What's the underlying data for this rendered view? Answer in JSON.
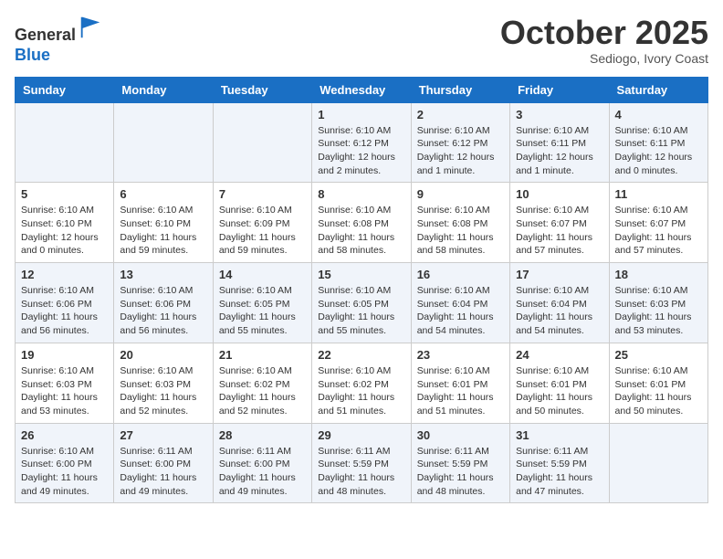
{
  "header": {
    "logo_line1": "General",
    "logo_line2": "Blue",
    "month": "October 2025",
    "location": "Sediogo, Ivory Coast"
  },
  "days_of_week": [
    "Sunday",
    "Monday",
    "Tuesday",
    "Wednesday",
    "Thursday",
    "Friday",
    "Saturday"
  ],
  "weeks": [
    [
      {
        "day": "",
        "info": ""
      },
      {
        "day": "",
        "info": ""
      },
      {
        "day": "",
        "info": ""
      },
      {
        "day": "1",
        "info": "Sunrise: 6:10 AM\nSunset: 6:12 PM\nDaylight: 12 hours and 2 minutes."
      },
      {
        "day": "2",
        "info": "Sunrise: 6:10 AM\nSunset: 6:12 PM\nDaylight: 12 hours and 1 minute."
      },
      {
        "day": "3",
        "info": "Sunrise: 6:10 AM\nSunset: 6:11 PM\nDaylight: 12 hours and 1 minute."
      },
      {
        "day": "4",
        "info": "Sunrise: 6:10 AM\nSunset: 6:11 PM\nDaylight: 12 hours and 0 minutes."
      }
    ],
    [
      {
        "day": "5",
        "info": "Sunrise: 6:10 AM\nSunset: 6:10 PM\nDaylight: 12 hours and 0 minutes."
      },
      {
        "day": "6",
        "info": "Sunrise: 6:10 AM\nSunset: 6:10 PM\nDaylight: 11 hours and 59 minutes."
      },
      {
        "day": "7",
        "info": "Sunrise: 6:10 AM\nSunset: 6:09 PM\nDaylight: 11 hours and 59 minutes."
      },
      {
        "day": "8",
        "info": "Sunrise: 6:10 AM\nSunset: 6:08 PM\nDaylight: 11 hours and 58 minutes."
      },
      {
        "day": "9",
        "info": "Sunrise: 6:10 AM\nSunset: 6:08 PM\nDaylight: 11 hours and 58 minutes."
      },
      {
        "day": "10",
        "info": "Sunrise: 6:10 AM\nSunset: 6:07 PM\nDaylight: 11 hours and 57 minutes."
      },
      {
        "day": "11",
        "info": "Sunrise: 6:10 AM\nSunset: 6:07 PM\nDaylight: 11 hours and 57 minutes."
      }
    ],
    [
      {
        "day": "12",
        "info": "Sunrise: 6:10 AM\nSunset: 6:06 PM\nDaylight: 11 hours and 56 minutes."
      },
      {
        "day": "13",
        "info": "Sunrise: 6:10 AM\nSunset: 6:06 PM\nDaylight: 11 hours and 56 minutes."
      },
      {
        "day": "14",
        "info": "Sunrise: 6:10 AM\nSunset: 6:05 PM\nDaylight: 11 hours and 55 minutes."
      },
      {
        "day": "15",
        "info": "Sunrise: 6:10 AM\nSunset: 6:05 PM\nDaylight: 11 hours and 55 minutes."
      },
      {
        "day": "16",
        "info": "Sunrise: 6:10 AM\nSunset: 6:04 PM\nDaylight: 11 hours and 54 minutes."
      },
      {
        "day": "17",
        "info": "Sunrise: 6:10 AM\nSunset: 6:04 PM\nDaylight: 11 hours and 54 minutes."
      },
      {
        "day": "18",
        "info": "Sunrise: 6:10 AM\nSunset: 6:03 PM\nDaylight: 11 hours and 53 minutes."
      }
    ],
    [
      {
        "day": "19",
        "info": "Sunrise: 6:10 AM\nSunset: 6:03 PM\nDaylight: 11 hours and 53 minutes."
      },
      {
        "day": "20",
        "info": "Sunrise: 6:10 AM\nSunset: 6:03 PM\nDaylight: 11 hours and 52 minutes."
      },
      {
        "day": "21",
        "info": "Sunrise: 6:10 AM\nSunset: 6:02 PM\nDaylight: 11 hours and 52 minutes."
      },
      {
        "day": "22",
        "info": "Sunrise: 6:10 AM\nSunset: 6:02 PM\nDaylight: 11 hours and 51 minutes."
      },
      {
        "day": "23",
        "info": "Sunrise: 6:10 AM\nSunset: 6:01 PM\nDaylight: 11 hours and 51 minutes."
      },
      {
        "day": "24",
        "info": "Sunrise: 6:10 AM\nSunset: 6:01 PM\nDaylight: 11 hours and 50 minutes."
      },
      {
        "day": "25",
        "info": "Sunrise: 6:10 AM\nSunset: 6:01 PM\nDaylight: 11 hours and 50 minutes."
      }
    ],
    [
      {
        "day": "26",
        "info": "Sunrise: 6:10 AM\nSunset: 6:00 PM\nDaylight: 11 hours and 49 minutes."
      },
      {
        "day": "27",
        "info": "Sunrise: 6:11 AM\nSunset: 6:00 PM\nDaylight: 11 hours and 49 minutes."
      },
      {
        "day": "28",
        "info": "Sunrise: 6:11 AM\nSunset: 6:00 PM\nDaylight: 11 hours and 49 minutes."
      },
      {
        "day": "29",
        "info": "Sunrise: 6:11 AM\nSunset: 5:59 PM\nDaylight: 11 hours and 48 minutes."
      },
      {
        "day": "30",
        "info": "Sunrise: 6:11 AM\nSunset: 5:59 PM\nDaylight: 11 hours and 48 minutes."
      },
      {
        "day": "31",
        "info": "Sunrise: 6:11 AM\nSunset: 5:59 PM\nDaylight: 11 hours and 47 minutes."
      },
      {
        "day": "",
        "info": ""
      }
    ]
  ]
}
